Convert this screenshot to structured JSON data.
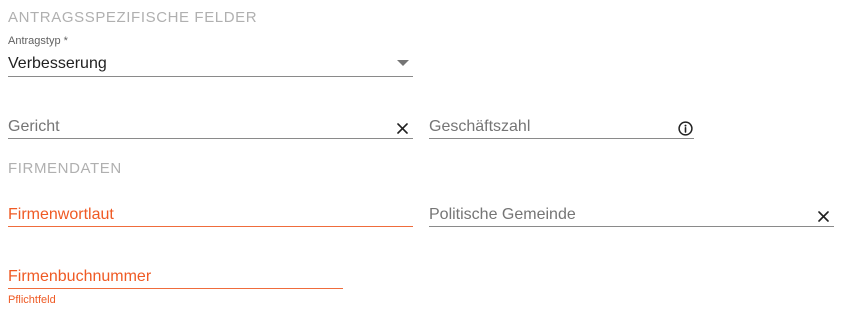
{
  "sections": {
    "request_fields_title": "ANTRAGSSPEZIFISCHE FELDER",
    "company_data_title": "FIRMENDATEN"
  },
  "antragstyp": {
    "label": "Antragstyp *",
    "value": "Verbesserung",
    "icon": "dropdown-arrow-icon"
  },
  "gericht": {
    "label": "Gericht",
    "icon": "clear-icon"
  },
  "geschaeftszahl": {
    "label": "Geschäftszahl",
    "icon": "info-icon"
  },
  "firmenwortlaut": {
    "label": "Firmenwortlaut"
  },
  "politische_gemeinde": {
    "label": "Politische Gemeinde",
    "icon": "clear-icon"
  },
  "firmenbuchnummer": {
    "label": "Firmenbuchnummer",
    "hint": "Pflichtfeld"
  },
  "colors": {
    "error": "#ef5a24",
    "section_title": "#b0b0b0",
    "underline": "#8a8a8a"
  }
}
